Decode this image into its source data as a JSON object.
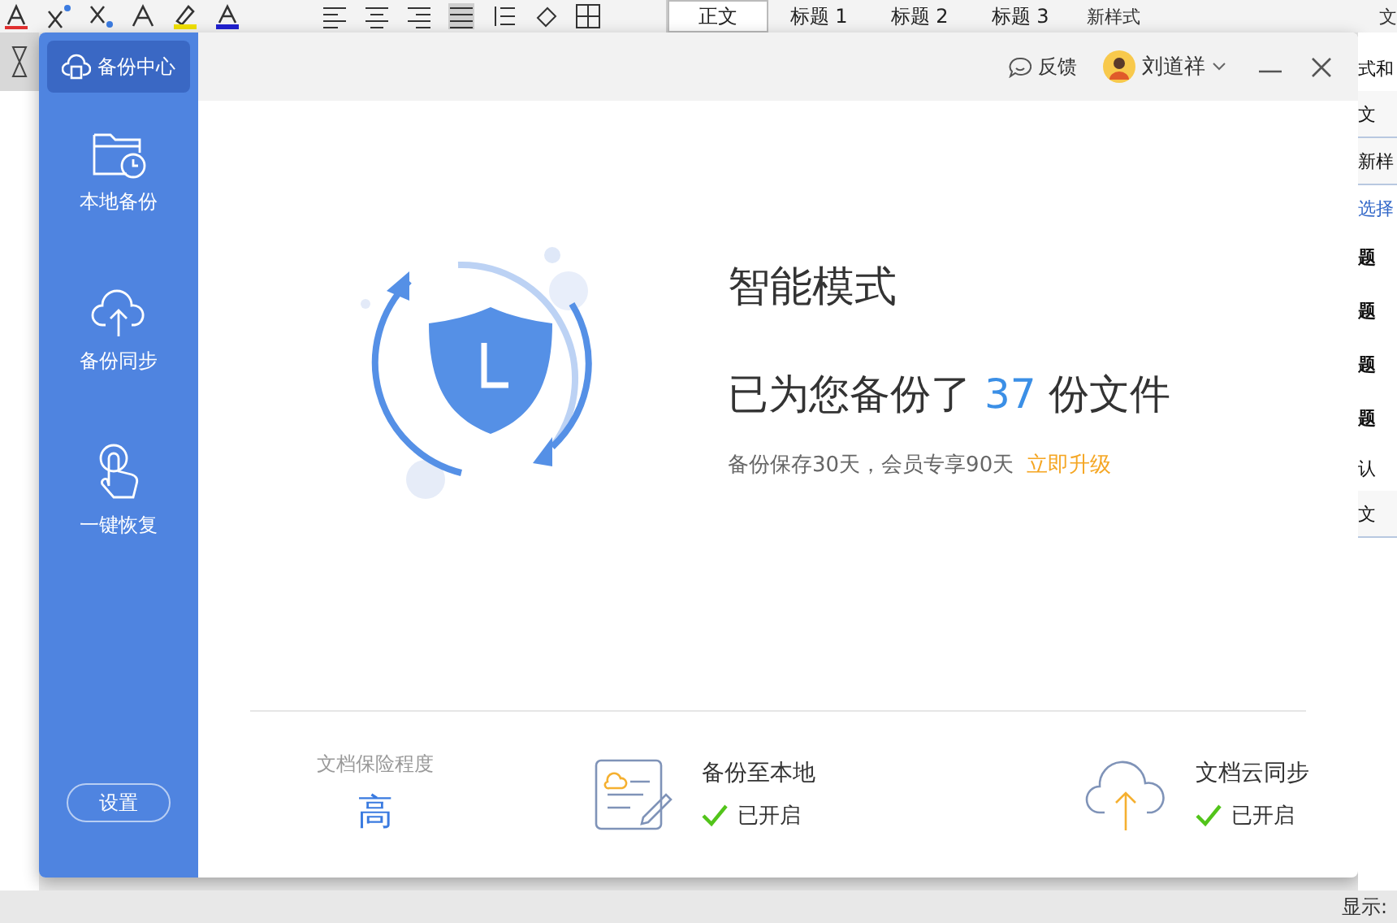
{
  "toolbar": {
    "styles": [
      {
        "label": "正文",
        "selected": true
      },
      {
        "label": "标题 1",
        "selected": false
      },
      {
        "label": "标题 2",
        "selected": false
      },
      {
        "label": "标题 3",
        "selected": false
      }
    ],
    "more_styles": "新样式",
    "cut_label": "文"
  },
  "dialog": {
    "sidebar": {
      "header": {
        "label": "备份中心",
        "selected": true
      },
      "items": [
        {
          "label": "本地备份",
          "kind": "folder",
          "selected": false
        },
        {
          "label": "备份同步",
          "kind": "cloud",
          "selected": false
        },
        {
          "label": "一键恢复",
          "kind": "hand",
          "selected": false
        }
      ],
      "settings": "设置"
    },
    "header": {
      "feedback": "反馈",
      "user": "刘道祥"
    },
    "status": {
      "mode": "智能模式",
      "summary_prefix": "已为您备份了",
      "count": "37",
      "summary_suffix": "份文件",
      "note": "备份保存30天，会员专享90天",
      "upgrade": "立即升级"
    },
    "footer": {
      "level_label": "文档保险程度",
      "level": "高",
      "features": [
        {
          "kind": "local",
          "title": "备份至本地",
          "status": "已开启",
          "on": true
        },
        {
          "kind": "cloud",
          "title": "文档云同步",
          "status": "已开启",
          "on": true
        }
      ]
    }
  },
  "side_panel": {
    "items": [
      {
        "text": "式和",
        "kind": "plain"
      },
      {
        "text": "文",
        "kind": "field"
      },
      {
        "text": "新样",
        "kind": "field"
      },
      {
        "text": "选择",
        "kind": "link"
      },
      {
        "text": "题",
        "kind": "heading"
      },
      {
        "text": "题",
        "kind": "heading"
      },
      {
        "text": "题",
        "kind": "heading"
      },
      {
        "text": "题",
        "kind": "heading"
      },
      {
        "text": "认",
        "kind": "plain"
      },
      {
        "text": "文",
        "kind": "field"
      }
    ]
  },
  "bottom_bar": {
    "label": "显示:"
  }
}
